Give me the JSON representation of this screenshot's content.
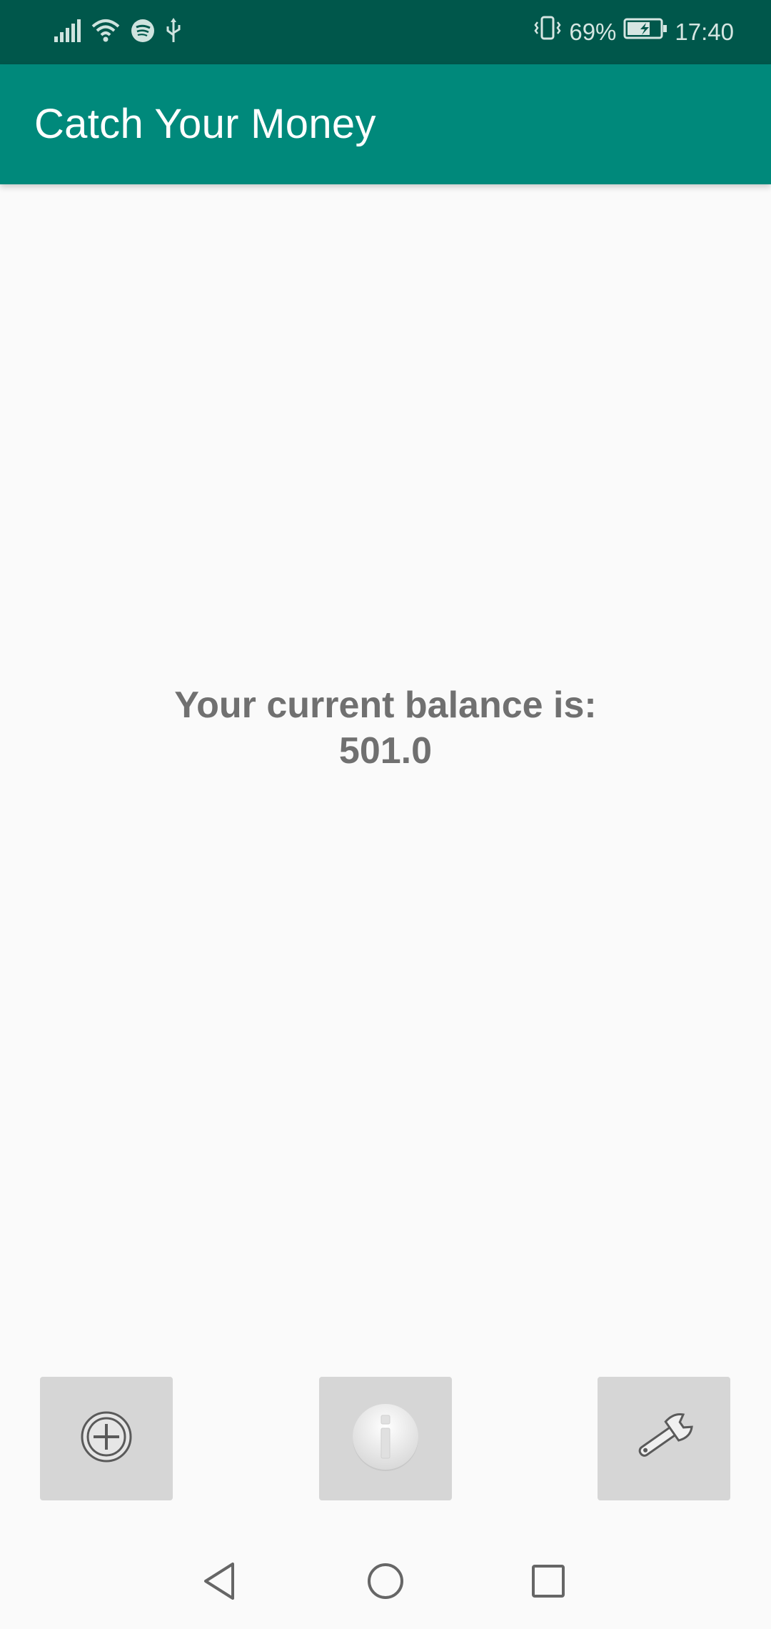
{
  "status_bar": {
    "battery_percent": "69%",
    "time": "17:40",
    "left_icons": [
      "signal-icon",
      "wifi-icon",
      "spotify-icon",
      "usb-icon"
    ],
    "right_icons": [
      "vibrate-icon",
      "battery-charging-icon"
    ]
  },
  "app_bar": {
    "title": "Catch Your Money",
    "color": "#00897b"
  },
  "main": {
    "balance_label": "Your current balance is:",
    "balance_value": "501.0"
  },
  "toolbar": {
    "buttons": [
      {
        "name": "add-button",
        "icon": "add-circle-icon"
      },
      {
        "name": "info-button",
        "icon": "info-icon"
      },
      {
        "name": "settings-button",
        "icon": "wrench-icon"
      }
    ]
  },
  "nav_bar": {
    "buttons": [
      "back-icon",
      "home-icon",
      "recents-icon"
    ]
  },
  "colors": {
    "status_bar": "#00574b",
    "accent": "#00897b",
    "button_bg": "#d6d6d6",
    "text": "#707070"
  }
}
